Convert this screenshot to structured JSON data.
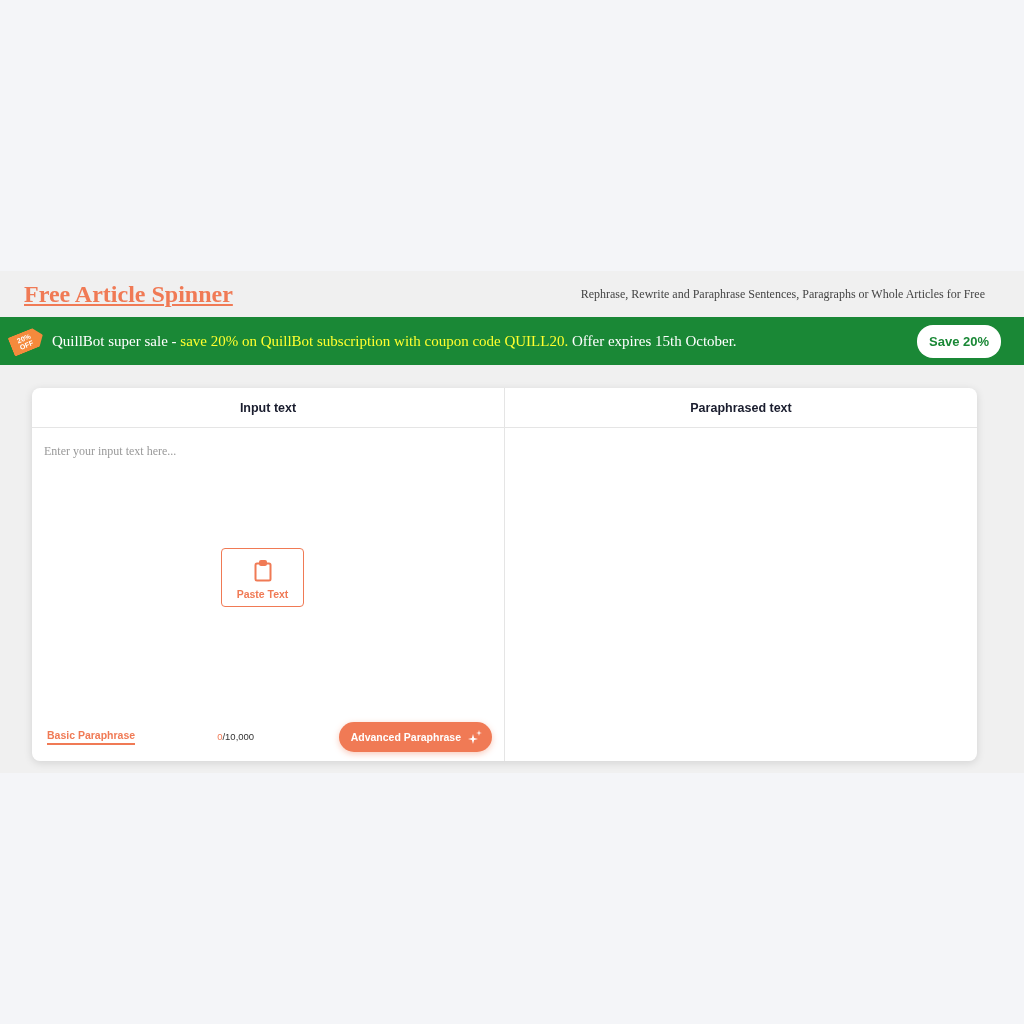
{
  "header": {
    "title": "Free Article Spinner",
    "tagline": "Rephrase, Rewrite and Paraphrase Sentences, Paragraphs or Whole Articles for Free"
  },
  "promo_banner": {
    "tag_lines": [
      "20%",
      "OFF"
    ],
    "message": [
      {
        "text": "QuillBot super sale -",
        "highlight": false
      },
      {
        "text": "save 20% on QuillBot subscription with coupon code QUILL20.",
        "highlight": true
      },
      {
        "text": "Offer expires 15th October.",
        "highlight": false
      }
    ],
    "button": "Save 20%"
  },
  "editor": {
    "input_panel": {
      "heading": "Input text",
      "placeholder": "Enter your input text here...",
      "paste_button": "Paste Text",
      "basic_mode": {
        "label": "Basic Paraphrase",
        "selected": true
      },
      "char_count": {
        "count": "0",
        "limit": "/10,000"
      },
      "advanced_button": "Advanced Paraphrase"
    },
    "output_panel": {
      "heading": "Paraphrased text"
    }
  }
}
